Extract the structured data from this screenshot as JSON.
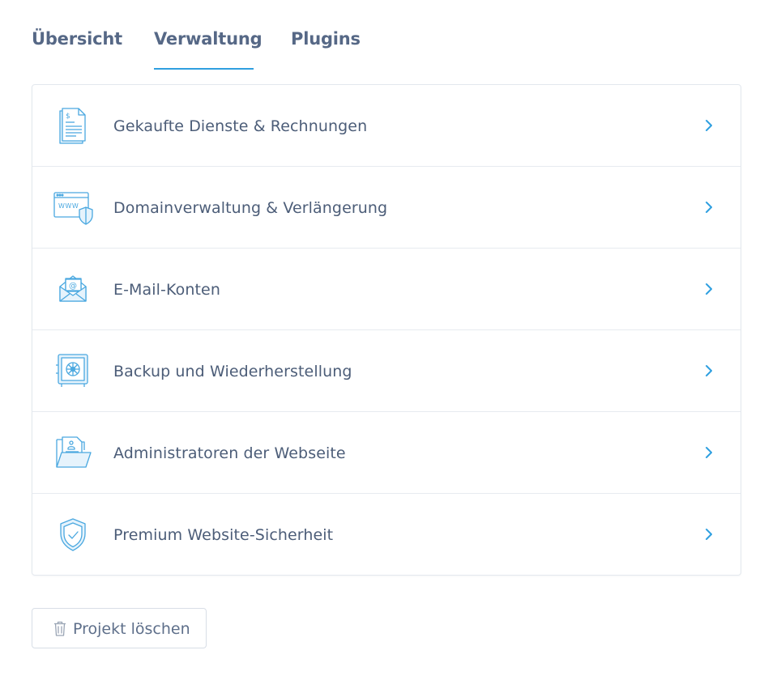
{
  "tabs": [
    {
      "label": "Übersicht",
      "active": false
    },
    {
      "label": "Verwaltung",
      "active": true
    },
    {
      "label": "Plugins",
      "active": false
    }
  ],
  "menu": [
    {
      "label": "Gekaufte Dienste & Rechnungen",
      "icon": "invoice-icon"
    },
    {
      "label": "Domainverwaltung & Verlängerung",
      "icon": "domain-shield-icon"
    },
    {
      "label": "E-Mail-Konten",
      "icon": "email-icon"
    },
    {
      "label": "Backup und Wiederherstellung",
      "icon": "safe-icon"
    },
    {
      "label": "Administratoren der Webseite",
      "icon": "admin-folder-icon"
    },
    {
      "label": "Premium Website-Sicherheit",
      "icon": "shield-check-icon"
    }
  ],
  "delete_button": {
    "label": "Projekt löschen",
    "icon": "trash-icon"
  },
  "colors": {
    "accent": "#2f9fe0",
    "text": "#4c5d78",
    "icon_stroke": "#4aa8e0",
    "icon_fill": "#e6f3fc"
  }
}
